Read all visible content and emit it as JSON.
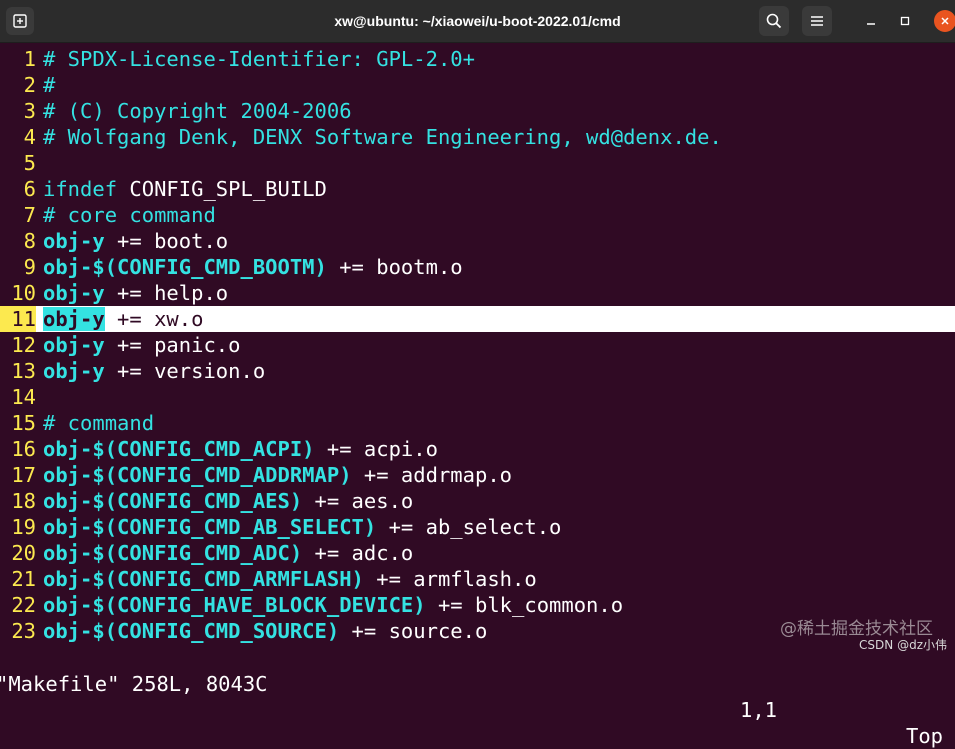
{
  "window": {
    "title": "xw@ubuntu: ~/xiaowei/u-boot-2022.01/cmd",
    "icons": [
      "new-tab-icon",
      "search-icon",
      "menu-icon",
      "minimize-icon",
      "maximize-icon",
      "close-icon"
    ],
    "close_color": "#e95420"
  },
  "colors": {
    "background": "#300a24",
    "line_number": "#fce94f",
    "keyword": "#34e2e2",
    "text": "#ffffff"
  },
  "editor": {
    "cursor_line": 11,
    "lines": [
      {
        "n": "1",
        "parts": [
          {
            "t": "# SPDX-License-Identifier: GPL-2.0+",
            "c": "cmt"
          }
        ]
      },
      {
        "n": "2",
        "parts": [
          {
            "t": "#",
            "c": "cmt"
          }
        ]
      },
      {
        "n": "3",
        "parts": [
          {
            "t": "# (C) Copyright 2004-2006",
            "c": "cmt"
          }
        ]
      },
      {
        "n": "4",
        "parts": [
          {
            "t": "# Wolfgang Denk, DENX Software Engineering, wd@denx.de.",
            "c": "cmt"
          }
        ]
      },
      {
        "n": "5",
        "parts": []
      },
      {
        "n": "6",
        "parts": [
          {
            "t": "ifndef",
            "c": "kw"
          },
          {
            "t": " CONFIG_SPL_BUILD",
            "c": "plain"
          }
        ]
      },
      {
        "n": "7",
        "parts": [
          {
            "t": "# core command",
            "c": "cmt"
          }
        ]
      },
      {
        "n": "8",
        "parts": [
          {
            "t": "obj-y",
            "c": "var"
          },
          {
            "t": " += boot.o",
            "c": "plain"
          }
        ]
      },
      {
        "n": "9",
        "parts": [
          {
            "t": "obj-$(CONFIG_CMD_BOOTM)",
            "c": "var"
          },
          {
            "t": " += bootm.o",
            "c": "plain"
          }
        ]
      },
      {
        "n": "10",
        "parts": [
          {
            "t": "obj-y",
            "c": "var"
          },
          {
            "t": " += help.o",
            "c": "plain"
          }
        ]
      },
      {
        "n": "11",
        "parts": [
          {
            "t": "obj-y",
            "c": "var"
          },
          {
            "t": " += xw.o",
            "c": "plain"
          }
        ]
      },
      {
        "n": "12",
        "parts": [
          {
            "t": "obj-y",
            "c": "var"
          },
          {
            "t": " += panic.o",
            "c": "plain"
          }
        ]
      },
      {
        "n": "13",
        "parts": [
          {
            "t": "obj-y",
            "c": "var"
          },
          {
            "t": " += version.o",
            "c": "plain"
          }
        ]
      },
      {
        "n": "14",
        "parts": []
      },
      {
        "n": "15",
        "parts": [
          {
            "t": "# command",
            "c": "cmt"
          }
        ]
      },
      {
        "n": "16",
        "parts": [
          {
            "t": "obj-$(CONFIG_CMD_ACPI)",
            "c": "var"
          },
          {
            "t": " += acpi.o",
            "c": "plain"
          }
        ]
      },
      {
        "n": "17",
        "parts": [
          {
            "t": "obj-$(CONFIG_CMD_ADDRMAP)",
            "c": "var"
          },
          {
            "t": " += addrmap.o",
            "c": "plain"
          }
        ]
      },
      {
        "n": "18",
        "parts": [
          {
            "t": "obj-$(CONFIG_CMD_AES)",
            "c": "var"
          },
          {
            "t": " += aes.o",
            "c": "plain"
          }
        ]
      },
      {
        "n": "19",
        "parts": [
          {
            "t": "obj-$(CONFIG_CMD_AB_SELECT)",
            "c": "var"
          },
          {
            "t": " += ab_select.o",
            "c": "plain"
          }
        ]
      },
      {
        "n": "20",
        "parts": [
          {
            "t": "obj-$(CONFIG_CMD_ADC)",
            "c": "var"
          },
          {
            "t": " += adc.o",
            "c": "plain"
          }
        ]
      },
      {
        "n": "21",
        "parts": [
          {
            "t": "obj-$(CONFIG_CMD_ARMFLASH)",
            "c": "var"
          },
          {
            "t": " += armflash.o",
            "c": "plain"
          }
        ]
      },
      {
        "n": "22",
        "parts": [
          {
            "t": "obj-$(CONFIG_HAVE_BLOCK_DEVICE)",
            "c": "var"
          },
          {
            "t": " += blk_common.o",
            "c": "plain"
          }
        ]
      },
      {
        "n": "23",
        "parts": [
          {
            "t": "obj-$(CONFIG_CMD_SOURCE)",
            "c": "var"
          },
          {
            "t": " += source.o",
            "c": "plain"
          }
        ]
      }
    ]
  },
  "status": {
    "file_info": "\"Makefile\" 258L, 8043C",
    "position": "1,1",
    "scroll": "Top"
  },
  "watermark": {
    "site": "@稀土掘金技术社区",
    "author": "CSDN @dz小伟"
  }
}
